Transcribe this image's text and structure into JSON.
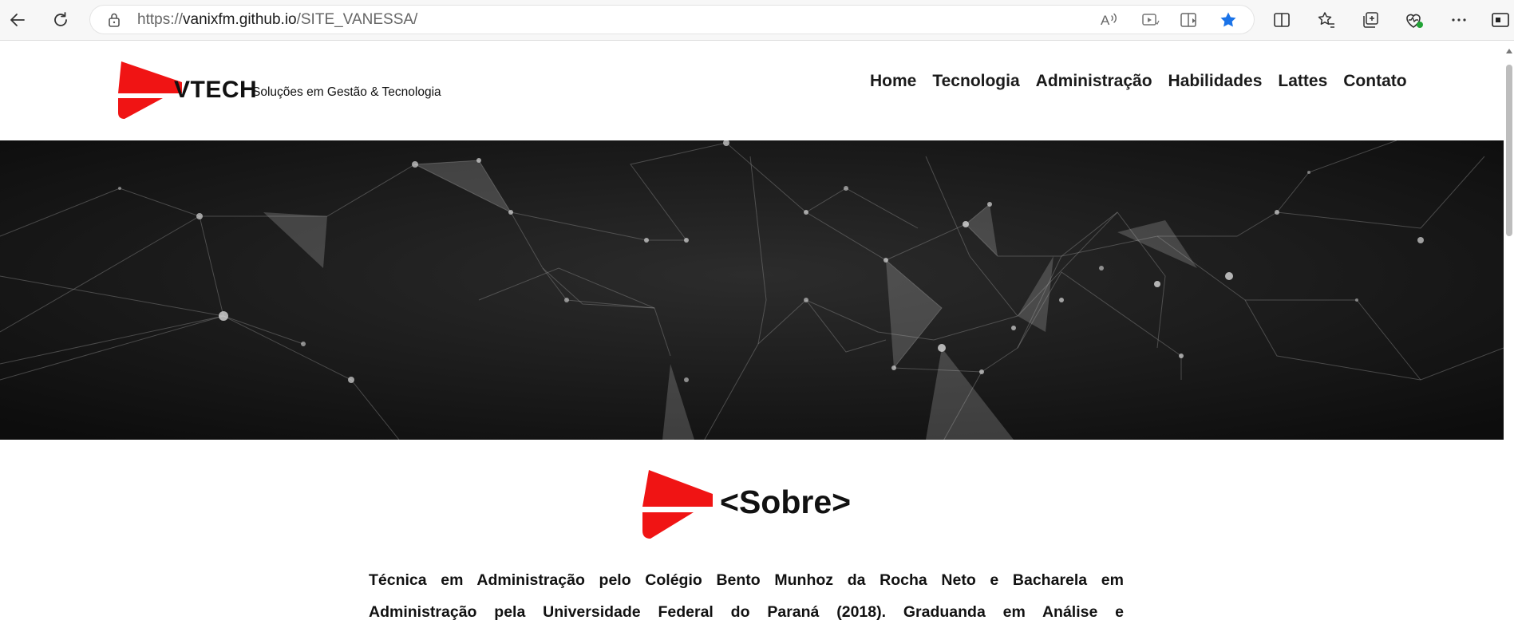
{
  "browser": {
    "url_scheme": "https://",
    "url_host": "vanixfm.github.io",
    "url_path": "/SITE_VANESSA/",
    "icons": [
      "back-icon",
      "refresh-icon",
      "lock-icon",
      "read-aloud-icon",
      "immersive-reader-icon",
      "reader-view-icon",
      "favorite-star-icon",
      "split-screen-icon",
      "favorites-icon",
      "collections-icon",
      "browser-essentials-icon",
      "more-icon",
      "sidebar-icon"
    ]
  },
  "header": {
    "brand": "VTECH",
    "tagline": "Soluções em Gestão & Tecnologia",
    "nav": [
      "Home",
      "Tecnologia",
      "Administração",
      "Habilidades",
      "Lattes",
      "Contato"
    ]
  },
  "hero": {
    "description_icon": "network-background"
  },
  "sobre": {
    "title": "<Sobre>",
    "paragraph_line1": "Técnica em Administração pelo Colégio Bento Munhoz da Rocha Neto e Bacharela em",
    "paragraph_line2": "Administração pela Universidade Federal do Paraná (2018). Graduanda em Análise e"
  },
  "colors": {
    "accent": "#f01414",
    "text": "#111111",
    "hero_bg": "#121212",
    "favorite_star": "#1a73e8"
  }
}
